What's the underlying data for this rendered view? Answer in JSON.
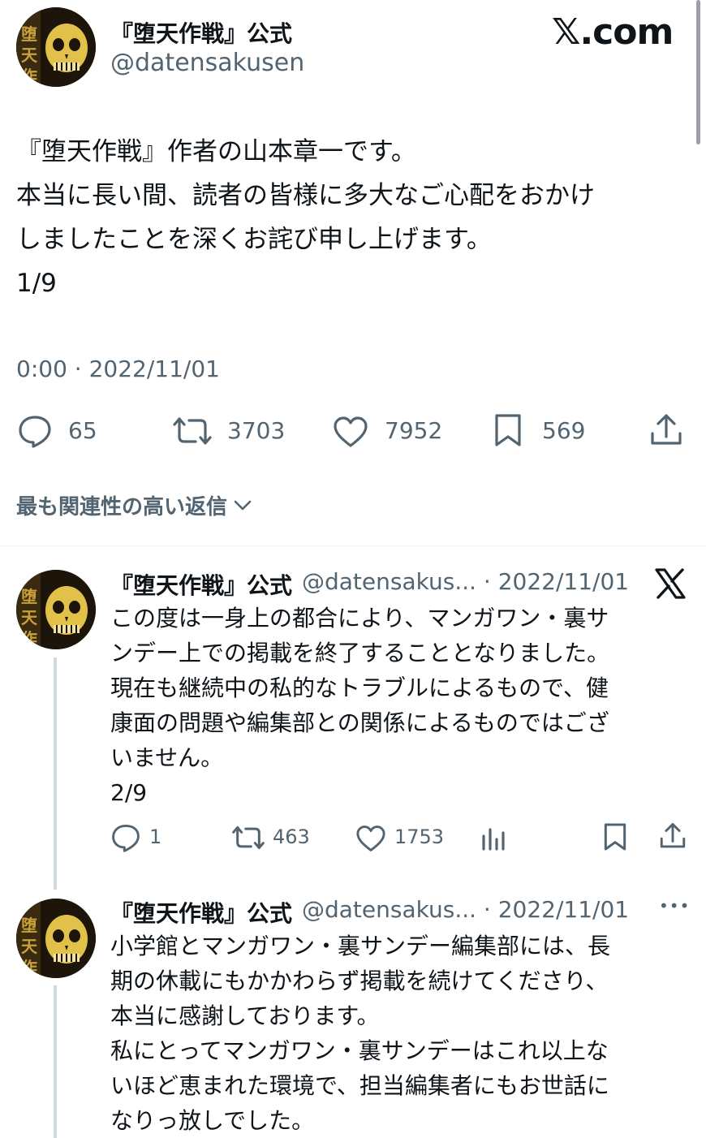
{
  "brand": "𝕏.com",
  "main_tweet": {
    "name": "『堕天作戦』公式",
    "handle": "@datensakusen",
    "lines": [
      "『堕天作戦』作者の山本章一です。",
      "本当に長い間、読者の皆様に多大なご心配をおかけ",
      "しましたことを深くお詫び申し上げます。",
      "1/9"
    ],
    "timestamp": "0:00 · 2022/11/01",
    "stats": {
      "replies": "65",
      "retweets": "3703",
      "likes": "7952",
      "bookmarks": "569"
    }
  },
  "sort_label": "最も関連性の高い返信",
  "replies": [
    {
      "name": "『堕天作戦』公式",
      "handle": "@datensakus... · 2022/11/01",
      "lines": [
        "この度は一身上の都合により、マンガワン・裏サ",
        "ンデー上での掲載を終了することとなりました。",
        "現在も継続中の私的なトラブルによるもので、健",
        "康面の問題や編集部との関係によるものではござ",
        "いません。",
        "2/9"
      ],
      "stats": {
        "replies": "1",
        "retweets": "463",
        "likes": "1753"
      }
    },
    {
      "name": "『堕天作戦』公式",
      "handle": "@datensakus... · 2022/11/01",
      "lines": [
        "小学館とマンガワン・裏サンデー編集部には、長",
        "期の休載にもかかわらず掲載を続けてくださり、",
        "本当に感謝しております。",
        "私にとってマンガワン・裏サンデーはこれ以上な",
        "いほど恵まれた環境で、担当編集者にもお世話に",
        "なりっ放しでした。"
      ]
    }
  ],
  "more_symbol": "•••"
}
